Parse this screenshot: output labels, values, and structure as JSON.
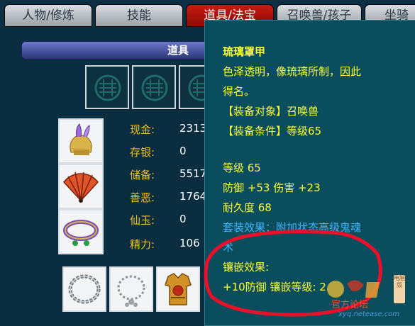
{
  "tabs": [
    {
      "label": "人物/修炼",
      "active": false
    },
    {
      "label": "技能",
      "active": false
    },
    {
      "label": "道具/法宝",
      "active": true
    },
    {
      "label": "召唤兽/孩子",
      "active": false
    },
    {
      "label": "坐骑",
      "active": false
    }
  ],
  "section": {
    "title": "道具"
  },
  "stats": [
    {
      "label": "现金:",
      "value": "2313"
    },
    {
      "label": "存银:",
      "value": "0"
    },
    {
      "label": "储备:",
      "value": "5517"
    },
    {
      "label": "善恶:",
      "value": "1764"
    },
    {
      "label": "仙玉:",
      "value": "0"
    },
    {
      "label": "精力:",
      "value": "106"
    }
  ],
  "equipment_icons": [
    "helmet-icon",
    "fan-icon",
    "ring-icon"
  ],
  "bottom_items": [
    "chain-icon",
    "beaded-chain-icon",
    "armor-icon"
  ],
  "tooltip": {
    "name": "琉璃罩甲",
    "desc1": "色泽透明，像琉璃所制，因此",
    "desc2": "得名。",
    "target": "【装备对象】召唤兽",
    "condition": "【装备条件】等级65",
    "level": "等级 65",
    "attrs": "防御 +53 伤害 +23",
    "durability": "耐久度 68",
    "set_effect1": "套装效果：附加状态高级鬼魂",
    "set_effect2": "术",
    "inlay_title": "镶嵌效果:",
    "inlay_value": "+10防御 镶嵌等级: 2"
  },
  "watermark": {
    "url": "xyq.netease.com",
    "version": "电脑版"
  },
  "colors": {
    "tooltip_text": "#ffff33",
    "tooltip_set": "#3fb7ff",
    "stat_label": "#f0c020",
    "tab_active": "#c71a10"
  }
}
